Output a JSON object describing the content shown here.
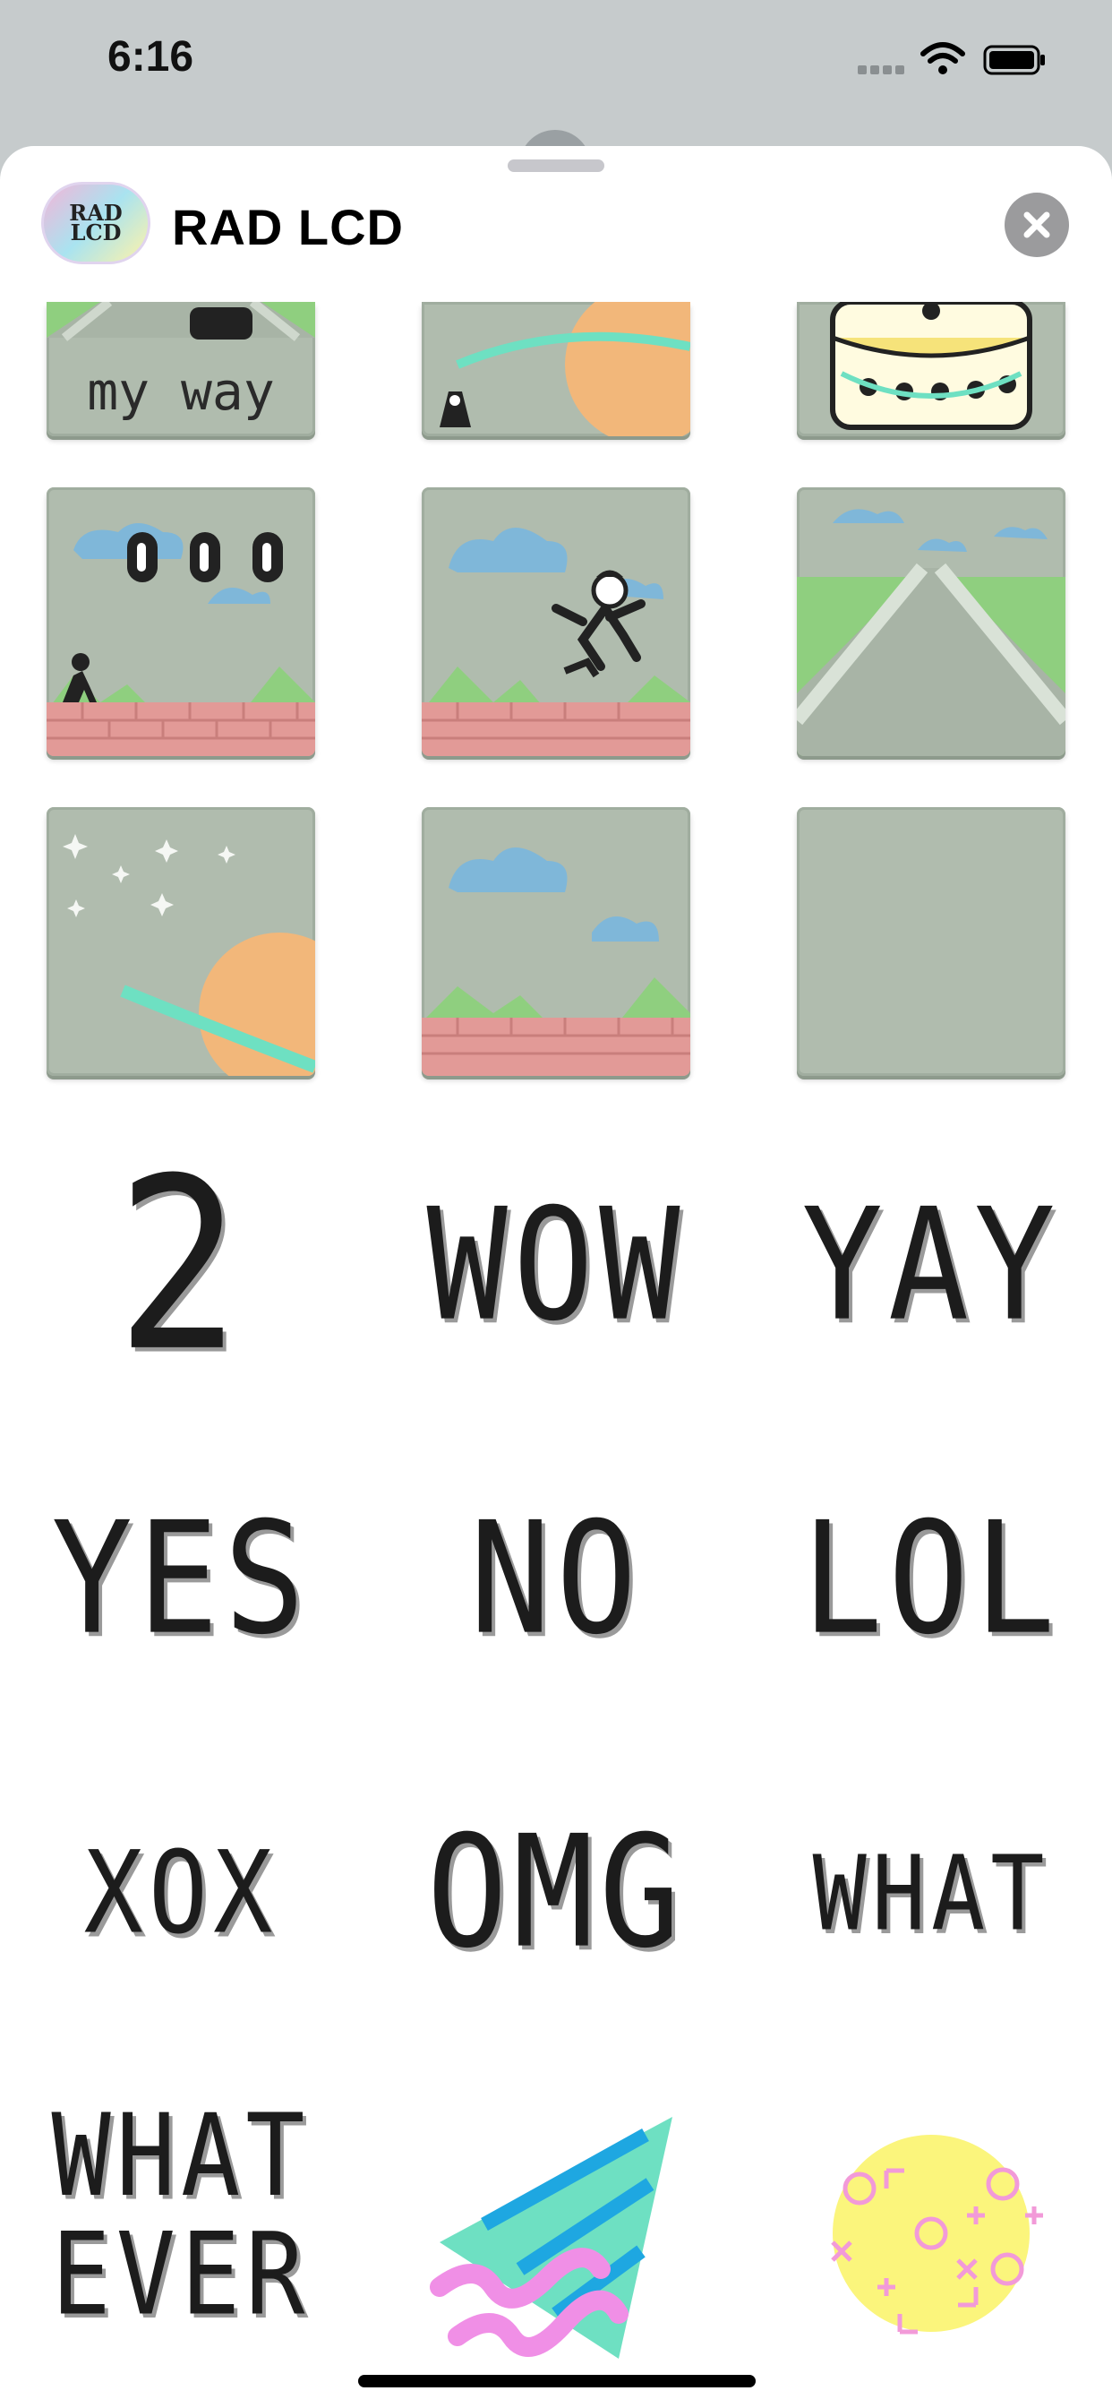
{
  "status_bar": {
    "time": "6:16"
  },
  "header": {
    "app_name": "RAD LCD",
    "icon_text": "RAD LCD"
  },
  "stickers": {
    "top_row_caption": "my way",
    "words": [
      "2",
      "WOW",
      "YAY",
      "YES",
      "NO",
      "LOL",
      "XOX",
      "OMG",
      "WHAT",
      "WHAT",
      "EVER"
    ]
  },
  "colors": {
    "tile_bg": "#b0bcae",
    "lcd_text": "#1c1c1c",
    "cloud": "#7fb7d9",
    "hill": "#8fcf7f",
    "brick": "#e29a97",
    "planet": "#f2b77a",
    "ring": "#6ee0c2"
  }
}
